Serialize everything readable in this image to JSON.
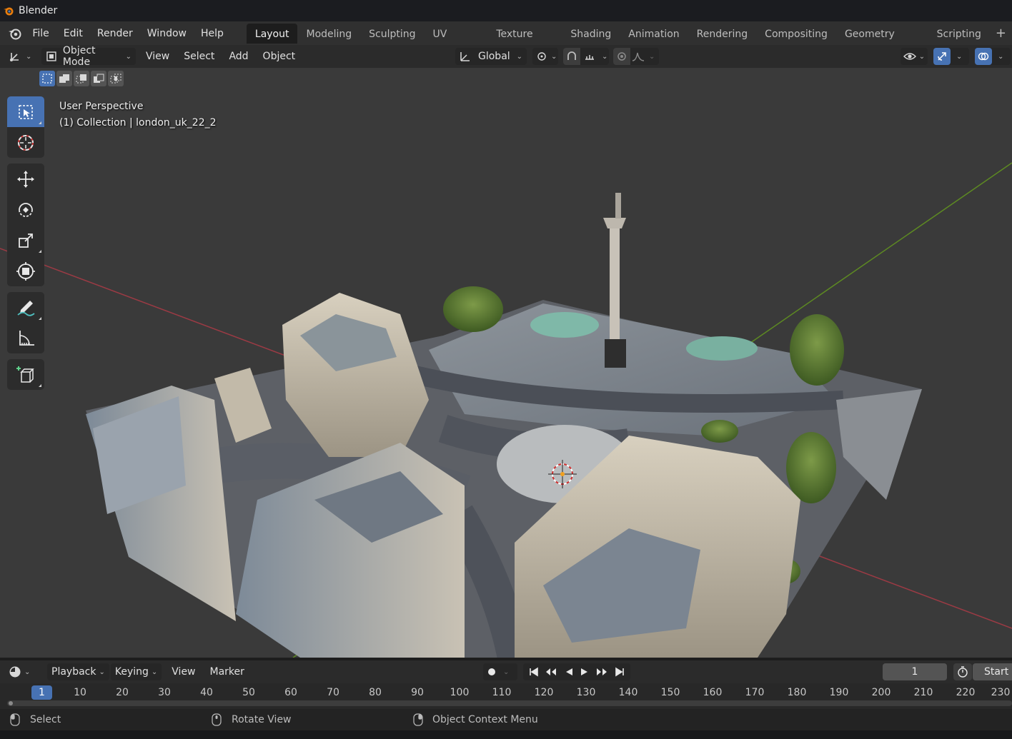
{
  "window": {
    "title": "Blender"
  },
  "menu": {
    "items": [
      "File",
      "Edit",
      "Render",
      "Window",
      "Help"
    ]
  },
  "workspaces": {
    "tabs": [
      "Layout",
      "Modeling",
      "Sculpting",
      "UV Editing",
      "Texture Paint",
      "Shading",
      "Animation",
      "Rendering",
      "Compositing",
      "Geometry Nodes",
      "Scripting"
    ],
    "active": "Layout"
  },
  "viewport_header": {
    "mode": "Object Mode",
    "menus": [
      "View",
      "Select",
      "Add",
      "Object"
    ],
    "orientation": "Global"
  },
  "viewport": {
    "perspective": "User Perspective",
    "collection": "(1) Collection | london_uk_22_2"
  },
  "toolbar": {
    "tools": [
      "select-box",
      "cursor",
      "move",
      "rotate",
      "scale",
      "transform",
      "annotate",
      "measure",
      "add-cube"
    ],
    "active": "select-box"
  },
  "timeline": {
    "menus": [
      "Playback",
      "Keying",
      "View",
      "Marker"
    ],
    "current_frame": "1",
    "start_label": "Start",
    "ruler_labels": [
      "1",
      "10",
      "20",
      "30",
      "40",
      "50",
      "60",
      "70",
      "80",
      "90",
      "100",
      "110",
      "120",
      "130",
      "140",
      "150",
      "160",
      "170",
      "180",
      "190",
      "200",
      "210",
      "220",
      "230"
    ]
  },
  "statusbar": {
    "select": "Select",
    "rotate": "Rotate View",
    "context": "Object Context Menu"
  },
  "colors": {
    "accent": "#4772b3",
    "x_axis": "#b4404a",
    "y_axis": "#6a9a2a",
    "viewport_bg": "#3a3a3a"
  }
}
